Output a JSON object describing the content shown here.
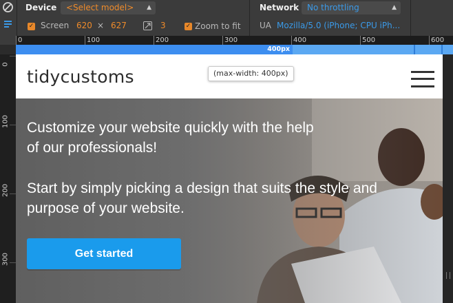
{
  "devtools": {
    "device_label": "Device",
    "device_select": "<Select model>",
    "network_label": "Network",
    "network_select": "No throttling",
    "screen_label": "Screen",
    "screen_width": "620",
    "times": "×",
    "screen_height": "627",
    "dpr_value": "3",
    "zoom_label": "Zoom to fit",
    "ua_label": "UA",
    "ua_value": "Mozilla/5.0 (iPhone; CPU iPh..."
  },
  "rulers": {
    "horizontal_ticks": [
      "0",
      "100",
      "200",
      "300",
      "400",
      "500",
      "600"
    ],
    "vertical_ticks": [
      "0",
      "100",
      "200",
      "300"
    ],
    "media_query_label": "400px"
  },
  "site": {
    "logo": "tidycustoms",
    "tooltip": "(max-width: 400px)",
    "hero_heading": "Customize your website quickly with the help of our professionals!",
    "hero_text": "Start by simply picking a design that suits the style and purpose of your website.",
    "cta_label": "Get started"
  },
  "colors": {
    "accent_orange": "#ef8b2a",
    "accent_blue": "#3b9ae8",
    "cta_blue": "#1a9bec",
    "media_bar": "#3d8ef0"
  },
  "icons": {
    "no_entry": "no-entry-icon",
    "device_mode": "device-mode-icon",
    "dpr": "device-pixel-ratio-icon",
    "menu": "hamburger-menu-icon"
  }
}
